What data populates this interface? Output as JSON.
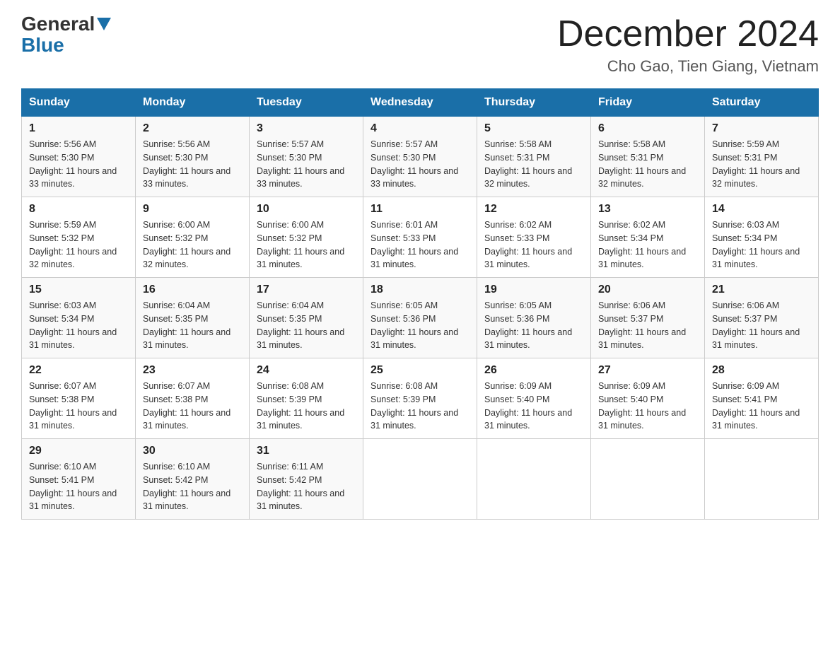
{
  "header": {
    "logo_general": "General",
    "logo_blue": "Blue",
    "title": "December 2024",
    "location": "Cho Gao, Tien Giang, Vietnam"
  },
  "days_of_week": [
    "Sunday",
    "Monday",
    "Tuesday",
    "Wednesday",
    "Thursday",
    "Friday",
    "Saturday"
  ],
  "weeks": [
    [
      {
        "day": "1",
        "sunrise": "5:56 AM",
        "sunset": "5:30 PM",
        "daylight": "11 hours and 33 minutes."
      },
      {
        "day": "2",
        "sunrise": "5:56 AM",
        "sunset": "5:30 PM",
        "daylight": "11 hours and 33 minutes."
      },
      {
        "day": "3",
        "sunrise": "5:57 AM",
        "sunset": "5:30 PM",
        "daylight": "11 hours and 33 minutes."
      },
      {
        "day": "4",
        "sunrise": "5:57 AM",
        "sunset": "5:30 PM",
        "daylight": "11 hours and 33 minutes."
      },
      {
        "day": "5",
        "sunrise": "5:58 AM",
        "sunset": "5:31 PM",
        "daylight": "11 hours and 32 minutes."
      },
      {
        "day": "6",
        "sunrise": "5:58 AM",
        "sunset": "5:31 PM",
        "daylight": "11 hours and 32 minutes."
      },
      {
        "day": "7",
        "sunrise": "5:59 AM",
        "sunset": "5:31 PM",
        "daylight": "11 hours and 32 minutes."
      }
    ],
    [
      {
        "day": "8",
        "sunrise": "5:59 AM",
        "sunset": "5:32 PM",
        "daylight": "11 hours and 32 minutes."
      },
      {
        "day": "9",
        "sunrise": "6:00 AM",
        "sunset": "5:32 PM",
        "daylight": "11 hours and 32 minutes."
      },
      {
        "day": "10",
        "sunrise": "6:00 AM",
        "sunset": "5:32 PM",
        "daylight": "11 hours and 31 minutes."
      },
      {
        "day": "11",
        "sunrise": "6:01 AM",
        "sunset": "5:33 PM",
        "daylight": "11 hours and 31 minutes."
      },
      {
        "day": "12",
        "sunrise": "6:02 AM",
        "sunset": "5:33 PM",
        "daylight": "11 hours and 31 minutes."
      },
      {
        "day": "13",
        "sunrise": "6:02 AM",
        "sunset": "5:34 PM",
        "daylight": "11 hours and 31 minutes."
      },
      {
        "day": "14",
        "sunrise": "6:03 AM",
        "sunset": "5:34 PM",
        "daylight": "11 hours and 31 minutes."
      }
    ],
    [
      {
        "day": "15",
        "sunrise": "6:03 AM",
        "sunset": "5:34 PM",
        "daylight": "11 hours and 31 minutes."
      },
      {
        "day": "16",
        "sunrise": "6:04 AM",
        "sunset": "5:35 PM",
        "daylight": "11 hours and 31 minutes."
      },
      {
        "day": "17",
        "sunrise": "6:04 AM",
        "sunset": "5:35 PM",
        "daylight": "11 hours and 31 minutes."
      },
      {
        "day": "18",
        "sunrise": "6:05 AM",
        "sunset": "5:36 PM",
        "daylight": "11 hours and 31 minutes."
      },
      {
        "day": "19",
        "sunrise": "6:05 AM",
        "sunset": "5:36 PM",
        "daylight": "11 hours and 31 minutes."
      },
      {
        "day": "20",
        "sunrise": "6:06 AM",
        "sunset": "5:37 PM",
        "daylight": "11 hours and 31 minutes."
      },
      {
        "day": "21",
        "sunrise": "6:06 AM",
        "sunset": "5:37 PM",
        "daylight": "11 hours and 31 minutes."
      }
    ],
    [
      {
        "day": "22",
        "sunrise": "6:07 AM",
        "sunset": "5:38 PM",
        "daylight": "11 hours and 31 minutes."
      },
      {
        "day": "23",
        "sunrise": "6:07 AM",
        "sunset": "5:38 PM",
        "daylight": "11 hours and 31 minutes."
      },
      {
        "day": "24",
        "sunrise": "6:08 AM",
        "sunset": "5:39 PM",
        "daylight": "11 hours and 31 minutes."
      },
      {
        "day": "25",
        "sunrise": "6:08 AM",
        "sunset": "5:39 PM",
        "daylight": "11 hours and 31 minutes."
      },
      {
        "day": "26",
        "sunrise": "6:09 AM",
        "sunset": "5:40 PM",
        "daylight": "11 hours and 31 minutes."
      },
      {
        "day": "27",
        "sunrise": "6:09 AM",
        "sunset": "5:40 PM",
        "daylight": "11 hours and 31 minutes."
      },
      {
        "day": "28",
        "sunrise": "6:09 AM",
        "sunset": "5:41 PM",
        "daylight": "11 hours and 31 minutes."
      }
    ],
    [
      {
        "day": "29",
        "sunrise": "6:10 AM",
        "sunset": "5:41 PM",
        "daylight": "11 hours and 31 minutes."
      },
      {
        "day": "30",
        "sunrise": "6:10 AM",
        "sunset": "5:42 PM",
        "daylight": "11 hours and 31 minutes."
      },
      {
        "day": "31",
        "sunrise": "6:11 AM",
        "sunset": "5:42 PM",
        "daylight": "11 hours and 31 minutes."
      },
      null,
      null,
      null,
      null
    ]
  ]
}
